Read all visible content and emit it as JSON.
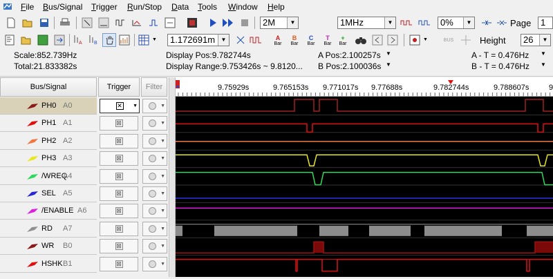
{
  "menu": [
    {
      "label": "File",
      "u": "F"
    },
    {
      "label": "Bus/Signal",
      "u": "B"
    },
    {
      "label": "Trigger",
      "u": "T"
    },
    {
      "label": "Run/Stop",
      "u": "R"
    },
    {
      "label": "Data",
      "u": "D"
    },
    {
      "label": "Tools",
      "u": "T"
    },
    {
      "label": "Window",
      "u": "W"
    },
    {
      "label": "Help",
      "u": "H"
    }
  ],
  "toolbar1": {
    "sample_depth": "2M",
    "sample_rate": "1MHz",
    "zoom": "0%",
    "page_label": "Page",
    "page_value": "1"
  },
  "toolbar2": {
    "time_value": "1.172691m",
    "bus_label": "BUS",
    "height_label": "Height",
    "height_value": "26",
    "bar_label": "Bar"
  },
  "info": {
    "scale": "Scale:852.739Hz",
    "total": "Total:21.833382s",
    "display_pos": "Display Pos:9.782744s",
    "display_range": "Display Range:9.753426s ~ 9.8120...",
    "a_pos": "A Pos:2.100257s",
    "b_pos": "B Pos:2.100036s",
    "a_t": "A - T = 0.476Hz",
    "b_t": "B - T = 0.476Hz"
  },
  "table_headers": {
    "bus_signal": "Bus/Signal",
    "trigger": "Trigger",
    "filter": "Filter"
  },
  "ruler_ticks": [
    "9.75929s",
    "9.765153s",
    "9.771017s",
    "9.77688s",
    "9.782744s",
    "9.788607s",
    "9."
  ],
  "signals": [
    {
      "name": "PH0",
      "pin": "A0",
      "color": "#8b1a1a",
      "selected": true
    },
    {
      "name": "PH1",
      "pin": "A1",
      "color": "#e01010",
      "selected": false
    },
    {
      "name": "PH2",
      "pin": "A2",
      "color": "#f07840",
      "selected": false
    },
    {
      "name": "PH3",
      "pin": "A3",
      "color": "#e8e820",
      "selected": false
    },
    {
      "name": "/WREQ",
      "pin": "A4",
      "color": "#30d860",
      "selected": false
    },
    {
      "name": "SEL",
      "pin": "A5",
      "color": "#2828d0",
      "selected": false
    },
    {
      "name": "/ENABLE",
      "pin": "A6",
      "color": "#e020e0",
      "selected": false
    },
    {
      "name": "RD",
      "pin": "A7",
      "color": "#909090",
      "selected": false
    },
    {
      "name": "WR",
      "pin": "B0",
      "color": "#8b1a1a",
      "selected": false
    },
    {
      "name": "HSHK",
      "pin": "B1",
      "color": "#e01010",
      "selected": false
    }
  ]
}
